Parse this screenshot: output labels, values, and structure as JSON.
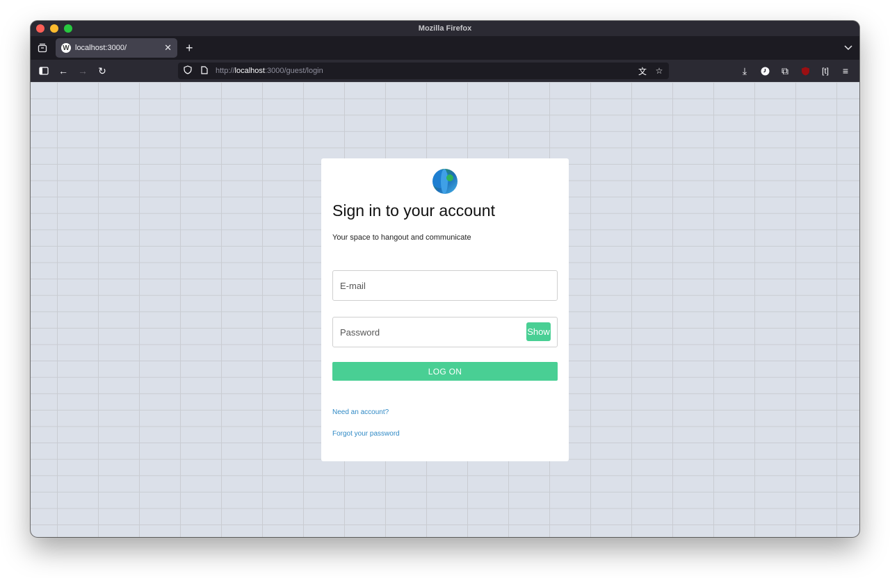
{
  "browser": {
    "window_title": "Mozilla Firefox",
    "tab": {
      "title": "localhost:3000/",
      "favicon": "wordpress-icon"
    },
    "url": {
      "scheme": "http://",
      "host": "localhost",
      "rest": ":3000/guest/login"
    }
  },
  "login": {
    "title": "Sign in to your account",
    "subtitle": "Your space to hangout and communicate",
    "email_placeholder": "E-mail",
    "password_placeholder": "Password",
    "show_label": "Show",
    "logon_label": "LOG ON",
    "need_account_label": "Need an account?",
    "forgot_password_label": "Forgot your password"
  },
  "colors": {
    "accent": "#49cf94",
    "link": "#2f89c5",
    "background": "#dbe0e9"
  }
}
